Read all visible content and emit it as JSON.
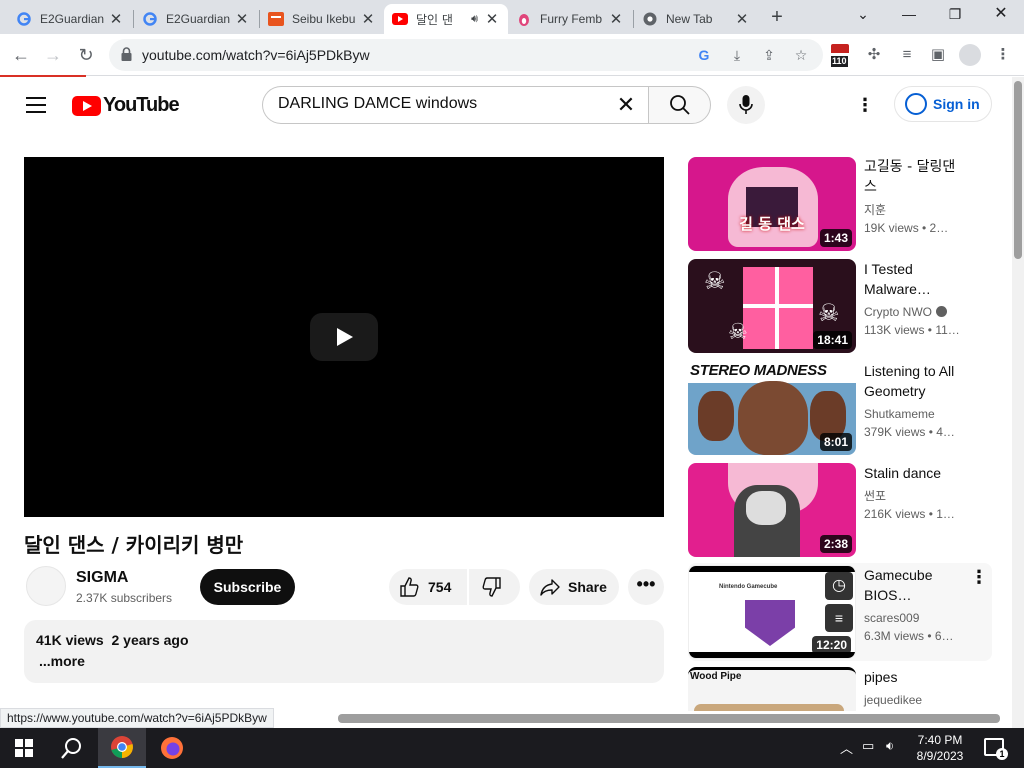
{
  "browser": {
    "tabs": [
      {
        "title": "E2Guardian",
        "favicon": "google-icon",
        "active": false
      },
      {
        "title": "E2Guardian",
        "favicon": "google-icon",
        "active": false
      },
      {
        "title": "Seibu Ikebu",
        "favicon": "seibu-icon",
        "active": false
      },
      {
        "title": "달인 댄",
        "favicon": "youtube-icon",
        "active": true,
        "audio": true
      },
      {
        "title": "Furry Femb",
        "favicon": "furry-icon",
        "active": false
      },
      {
        "title": "New Tab",
        "favicon": "chrome-icon",
        "active": false
      }
    ],
    "url": "youtube.com/watch?v=6iAj5PDkByw",
    "extension_badge": "110"
  },
  "youtube": {
    "logo_text": "YouTube",
    "search_value": "DARLING DAMCE windows",
    "sign_in": "Sign in"
  },
  "video": {
    "title": "달인 댄스 / 카이리키 병만",
    "channel": "SIGMA",
    "subscribers": "2.37K subscribers",
    "subscribe_label": "Subscribe",
    "likes": "754",
    "share_label": "Share",
    "description_meta": "41K views  2 years ago",
    "more_label": "...more"
  },
  "recommendations": [
    {
      "title": "고길동 - 달링댄스",
      "channel": "지훈",
      "views": "19K views  • 2…",
      "duration": "1:43",
      "thumb_text": "길 동 댄스",
      "verified": false
    },
    {
      "title": "I Tested Malware…",
      "channel": "Crypto NWO",
      "views": "113K views  • 11…",
      "duration": "18:41",
      "thumb_text": "",
      "verified": true
    },
    {
      "title": "Listening to All Geometry Das…",
      "channel": "Shutkameme",
      "views": "379K views  • 4…",
      "duration": "8:01",
      "thumb_text": "STEREO MADNESS",
      "verified": false
    },
    {
      "title": "Stalin dance",
      "channel": "썬포",
      "views": "216K views  • 1…",
      "duration": "2:38",
      "thumb_text": "",
      "verified": false
    },
    {
      "title": "Gamecube BIOS…",
      "channel": "scares009",
      "views": "6.3M views  • 6…",
      "duration": "12:20",
      "thumb_text": "Nintendo Gamecube",
      "verified": false
    },
    {
      "title": "pipes",
      "channel": "jequedikee",
      "views": "",
      "duration": "",
      "thumb_text": "Wood Pipe",
      "verified": false
    }
  ],
  "status_url": "https://www.youtube.com/watch?v=6iAj5PDkByw",
  "taskbar": {
    "time": "7:40 PM",
    "date": "8/9/2023",
    "notification_count": "1"
  },
  "colors": {
    "youtube_red": "#ff0000",
    "link_blue": "#065fd4",
    "tab_strip": "#dee1e6"
  }
}
